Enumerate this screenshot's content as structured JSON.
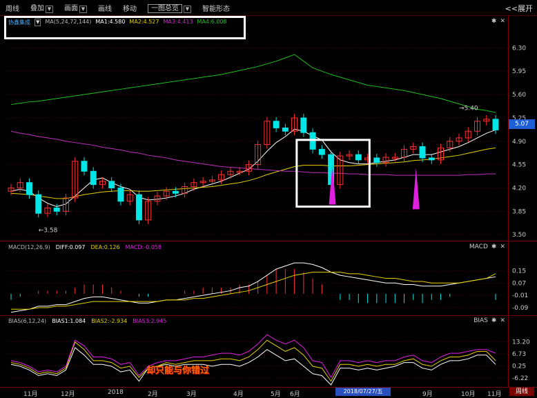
{
  "toolbar": {
    "items": [
      "周线",
      "叠加",
      "画面",
      "画线",
      "移动",
      "一图总览",
      "智能形态"
    ],
    "expand_label": "<<展开"
  },
  "legend": {
    "name": "协鑫集成",
    "ma_label": "MA(5,24,72,144)",
    "ma1": "MA1:4.580",
    "ma2": "MA2:4.527",
    "ma3": "MA3:4.413",
    "ma4": "MA4:6.008"
  },
  "colors": {
    "up": "#ff3030",
    "down": "#00e5e5",
    "ma1": "#ffffff",
    "ma2": "#e6d200",
    "ma3": "#c030c0",
    "ma4": "#20c020",
    "highlight_box": "#ffffff",
    "arrow": "#e020e0"
  },
  "last_price_tag": "5.07",
  "macd_panel": {
    "title": "MACD(12,26,9)",
    "diff": "DIFF:0.097",
    "dea": "DEA:0.126",
    "macd": "MACD:-0.058",
    "tag": "MACD"
  },
  "bias_panel": {
    "title": "BIAS(6,12,24)",
    "bias1": "BIAS1:1.084",
    "bias2": "BIAS2:-2.934",
    "bias3": "BIAS3:2.945",
    "tag": "BIAS"
  },
  "annotation_text": "却只能与你错过",
  "date_tag": "2018/07/27/五",
  "period_tag": "周线",
  "chart_data": [
    {
      "type": "line",
      "title": "",
      "y_ticks": [
        6.3,
        5.95,
        5.6,
        5.25,
        4.9,
        4.55,
        4.2,
        3.85,
        3.5
      ],
      "ylim": [
        3.45,
        6.5
      ],
      "x_labels": [
        "11月",
        "12月",
        "2018",
        "2月",
        "3月",
        "4月",
        "5月",
        "6月",
        "9月",
        "10月",
        "11月"
      ],
      "annotations": [
        "3.58",
        "5.40"
      ],
      "series": [
        {
          "name": "",
          "values": [
            4.2,
            4.28,
            4.1,
            3.82,
            3.9,
            3.85,
            4.05,
            4.6,
            4.45,
            4.25,
            4.3,
            4.2,
            4.0,
            4.1,
            3.72,
            4.0,
            4.08,
            4.15,
            4.12,
            4.22,
            4.28,
            4.3,
            4.32,
            4.4,
            4.45,
            4.45,
            4.55,
            4.85,
            5.2,
            5.1,
            5.05,
            5.25,
            5.03,
            4.78,
            4.7,
            4.25,
            4.68,
            4.7,
            4.62,
            4.65,
            4.58,
            4.66,
            4.66,
            4.78,
            4.82,
            4.65,
            4.62,
            4.8,
            4.9,
            4.95,
            5.05,
            5.2,
            5.23,
            5.07
          ]
        },
        {
          "name": "MA1",
          "values": [
            4.15,
            4.18,
            4.15,
            4.05,
            3.97,
            3.92,
            3.96,
            4.08,
            4.2,
            4.32,
            4.35,
            4.28,
            4.22,
            4.18,
            4.06,
            4.02,
            4.03,
            4.05,
            4.08,
            4.12,
            4.18,
            4.22,
            4.26,
            4.3,
            4.36,
            4.42,
            4.48,
            4.6,
            4.75,
            4.88,
            4.97,
            5.08,
            5.05,
            4.98,
            4.92,
            4.74,
            4.62,
            4.58,
            4.56,
            4.56,
            4.58,
            4.6,
            4.62,
            4.66,
            4.7,
            4.7,
            4.7,
            4.74,
            4.78,
            4.82,
            4.88,
            4.95,
            5.02,
            5.07
          ]
        },
        {
          "name": "MA2",
          "values": [
            4.12,
            4.11,
            4.1,
            4.08,
            4.06,
            4.04,
            4.04,
            4.07,
            4.1,
            4.12,
            4.14,
            4.15,
            4.16,
            4.16,
            4.15,
            4.15,
            4.16,
            4.17,
            4.18,
            4.19,
            4.2,
            4.21,
            4.22,
            4.24,
            4.26,
            4.28,
            4.31,
            4.35,
            4.4,
            4.44,
            4.48,
            4.52,
            4.54,
            4.54,
            4.54,
            4.53,
            4.53,
            4.53,
            4.54,
            4.55,
            4.56,
            4.57,
            4.58,
            4.59,
            4.61,
            4.62,
            4.63,
            4.65,
            4.67,
            4.69,
            4.72,
            4.75,
            4.78,
            4.8
          ]
        },
        {
          "name": "MA3",
          "values": [
            5.05,
            5.02,
            5.0,
            4.97,
            4.95,
            4.93,
            4.9,
            4.88,
            4.86,
            4.84,
            4.81,
            4.79,
            4.77,
            4.74,
            4.72,
            4.69,
            4.67,
            4.65,
            4.62,
            4.6,
            4.58,
            4.56,
            4.54,
            4.52,
            4.51,
            4.5,
            4.49,
            4.48,
            4.47,
            4.46,
            4.45,
            4.45,
            4.44,
            4.43,
            4.43,
            4.42,
            4.42,
            4.41,
            4.41,
            4.4,
            4.4,
            4.4,
            4.39,
            4.39,
            4.39,
            4.39,
            4.39,
            4.39,
            4.39,
            4.39,
            4.4,
            4.4,
            4.41,
            4.41
          ]
        },
        {
          "name": "MA4",
          "values": [
            5.45,
            5.47,
            5.49,
            5.5,
            5.52,
            5.54,
            5.56,
            5.58,
            5.6,
            5.62,
            5.64,
            5.66,
            5.68,
            5.7,
            5.72,
            5.74,
            5.76,
            5.78,
            5.8,
            5.82,
            5.84,
            5.86,
            5.88,
            5.9,
            5.93,
            5.96,
            5.99,
            6.02,
            6.06,
            6.1,
            6.15,
            6.2,
            6.1,
            6.0,
            5.95,
            5.9,
            5.86,
            5.82,
            5.78,
            5.74,
            5.72,
            5.7,
            5.68,
            5.66,
            5.63,
            5.6,
            5.57,
            5.54,
            5.5,
            5.46,
            5.42,
            5.38,
            5.36,
            5.33
          ]
        }
      ]
    },
    {
      "type": "line",
      "title": "",
      "y_ticks": [
        0.15,
        0.07,
        -0.01,
        -0.09
      ],
      "ylim": [
        -0.13,
        0.25
      ],
      "series": [
        {
          "name": "DIFF",
          "values": [
            -0.12,
            -0.11,
            -0.1,
            -0.08,
            -0.08,
            -0.07,
            -0.07,
            -0.05,
            -0.03,
            -0.02,
            -0.02,
            -0.03,
            -0.04,
            -0.05,
            -0.06,
            -0.06,
            -0.05,
            -0.04,
            -0.04,
            -0.03,
            -0.02,
            -0.01,
            0.0,
            0.01,
            0.02,
            0.04,
            0.05,
            0.08,
            0.12,
            0.16,
            0.18,
            0.2,
            0.2,
            0.19,
            0.17,
            0.14,
            0.12,
            0.11,
            0.1,
            0.09,
            0.08,
            0.07,
            0.07,
            0.06,
            0.06,
            0.05,
            0.05,
            0.05,
            0.06,
            0.07,
            0.08,
            0.09,
            0.1,
            0.11
          ]
        },
        {
          "name": "DEA",
          "values": [
            -0.1,
            -0.1,
            -0.1,
            -0.09,
            -0.09,
            -0.08,
            -0.08,
            -0.07,
            -0.06,
            -0.05,
            -0.05,
            -0.05,
            -0.05,
            -0.05,
            -0.05,
            -0.05,
            -0.05,
            -0.04,
            -0.04,
            -0.04,
            -0.03,
            -0.03,
            -0.02,
            -0.01,
            0.0,
            0.01,
            0.02,
            0.04,
            0.06,
            0.08,
            0.1,
            0.12,
            0.13,
            0.14,
            0.14,
            0.14,
            0.14,
            0.13,
            0.13,
            0.12,
            0.11,
            0.1,
            0.1,
            0.09,
            0.08,
            0.08,
            0.07,
            0.07,
            0.07,
            0.07,
            0.08,
            0.09,
            0.1,
            0.13
          ]
        }
      ]
    },
    {
      "type": "line",
      "title": "",
      "y_ticks": [
        13.2,
        6.73,
        0.25,
        -6.22
      ],
      "ylim": [
        -10,
        20
      ],
      "series": [
        {
          "name": "BIAS1",
          "values": [
            1,
            0,
            -2,
            -5,
            -4,
            -5,
            -2,
            10,
            6,
            1,
            1,
            0,
            -3,
            -2,
            -8,
            -1,
            0,
            1,
            0,
            1,
            1,
            1,
            0,
            1,
            1,
            0,
            2,
            5,
            9,
            6,
            3,
            4,
            0,
            -4,
            -5,
            -10,
            -1,
            -1,
            -2,
            -1,
            -2,
            -1,
            0,
            2,
            2,
            -1,
            -2,
            1,
            3,
            3,
            4,
            6,
            6,
            1
          ]
        },
        {
          "name": "BIAS2",
          "values": [
            2,
            1,
            -1,
            -4,
            -3,
            -4,
            -1,
            13,
            9,
            3,
            3,
            2,
            -1,
            0,
            -6,
            -1,
            0,
            2,
            1,
            2,
            3,
            3,
            3,
            4,
            4,
            3,
            5,
            9,
            14,
            11,
            8,
            10,
            6,
            0,
            -1,
            -8,
            1,
            1,
            0,
            1,
            0,
            1,
            1,
            3,
            4,
            1,
            0,
            3,
            5,
            5,
            6,
            8,
            8,
            3
          ]
        },
        {
          "name": "BIAS3",
          "values": [
            3,
            2,
            0,
            -3,
            -2,
            -3,
            0,
            14,
            11,
            5,
            5,
            4,
            1,
            2,
            -5,
            0,
            2,
            3,
            3,
            4,
            5,
            5,
            6,
            7,
            7,
            6,
            8,
            12,
            17,
            14,
            12,
            14,
            10,
            3,
            2,
            -6,
            3,
            3,
            2,
            3,
            2,
            3,
            3,
            5,
            6,
            3,
            2,
            5,
            7,
            7,
            8,
            9,
            9,
            7
          ]
        }
      ]
    }
  ]
}
